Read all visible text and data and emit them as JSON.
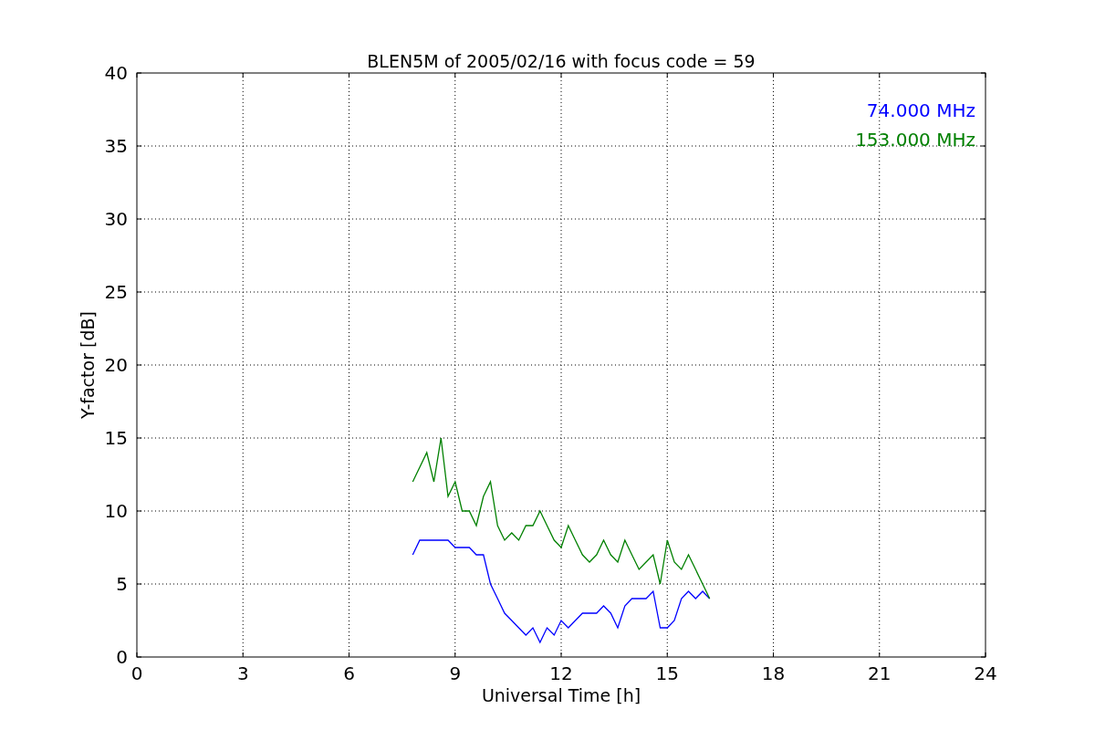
{
  "figure": {
    "chart_data": {
      "type": "line",
      "title": "BLEN5M of 2005/02/16 with focus code = 59",
      "xlabel": "Universal Time [h]",
      "ylabel": "Y-factor [dB]",
      "xlim": [
        0,
        24
      ],
      "ylim": [
        0,
        40
      ],
      "xticks": [
        0,
        3,
        6,
        9,
        12,
        15,
        18,
        21,
        24
      ],
      "yticks": [
        0,
        5,
        10,
        15,
        20,
        25,
        30,
        35,
        40
      ],
      "grid": true,
      "x": [
        7.8,
        8.0,
        8.2,
        8.4,
        8.6,
        8.8,
        9.0,
        9.2,
        9.4,
        9.6,
        9.8,
        10.0,
        10.2,
        10.4,
        10.6,
        10.8,
        11.0,
        11.2,
        11.4,
        11.6,
        11.8,
        12.0,
        12.2,
        12.4,
        12.6,
        12.8,
        13.0,
        13.2,
        13.4,
        13.6,
        13.8,
        14.0,
        14.2,
        14.4,
        14.6,
        14.8,
        15.0,
        15.2,
        15.4,
        15.6,
        15.8,
        16.0,
        16.2
      ],
      "series": [
        {
          "name": "74.000 MHz",
          "color": "#0000ff",
          "values": [
            7,
            8,
            8,
            8,
            8,
            8,
            7.5,
            7.5,
            7.5,
            7,
            7,
            5,
            4,
            3,
            2.5,
            2,
            1.5,
            2,
            1,
            2,
            1.5,
            2.5,
            2,
            2.5,
            3,
            3,
            3,
            3.5,
            3,
            2,
            3.5,
            4,
            4,
            4,
            4.5,
            2,
            2,
            2.5,
            4,
            4.5,
            4,
            4.5,
            4
          ]
        },
        {
          "name": "153.000 MHz",
          "color": "#008000",
          "values": [
            12,
            13,
            14,
            12,
            15,
            11,
            12,
            10,
            10,
            9,
            11,
            12,
            9,
            8,
            8.5,
            8,
            9,
            9,
            10,
            9,
            8,
            7.5,
            9,
            8,
            7,
            6.5,
            7,
            8,
            7,
            6.5,
            8,
            7,
            6,
            6.5,
            7,
            5,
            8,
            6.5,
            6,
            7,
            6,
            5,
            4
          ]
        }
      ]
    }
  }
}
